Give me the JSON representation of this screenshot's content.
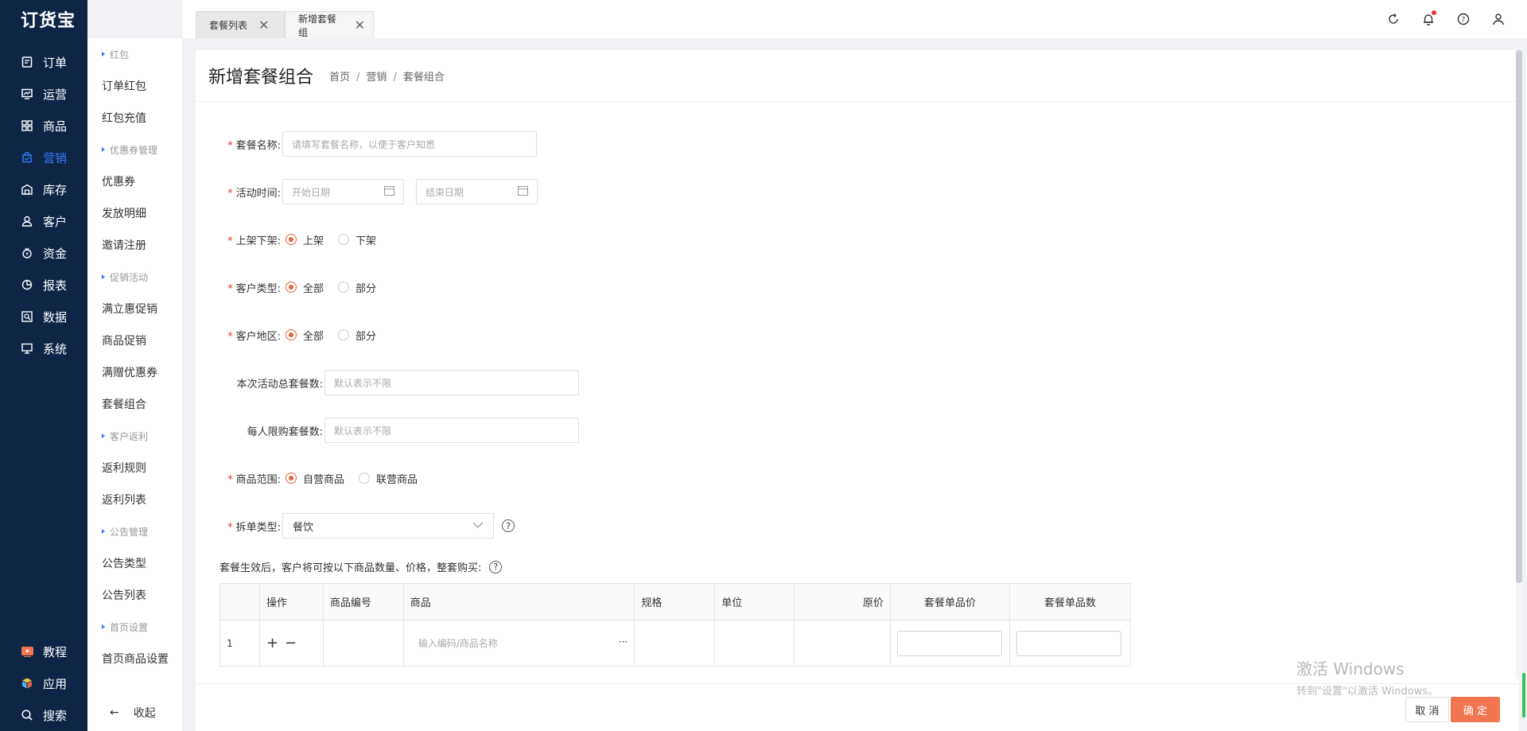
{
  "app": {
    "logo": "订货宝"
  },
  "nav": {
    "items": [
      {
        "label": "订单",
        "icon": "order-icon"
      },
      {
        "label": "运营",
        "icon": "operation-icon"
      },
      {
        "label": "商品",
        "icon": "goods-icon"
      },
      {
        "label": "营销",
        "icon": "marketing-icon",
        "active": true
      },
      {
        "label": "库存",
        "icon": "warehouse-icon"
      },
      {
        "label": "客户",
        "icon": "customer-icon"
      },
      {
        "label": "资金",
        "icon": "money-icon"
      },
      {
        "label": "报表",
        "icon": "report-icon"
      },
      {
        "label": "数据",
        "icon": "data-icon"
      },
      {
        "label": "系统",
        "icon": "system-icon"
      }
    ],
    "bottom": [
      {
        "label": "教程",
        "icon": "tutorial-icon"
      },
      {
        "label": "应用",
        "icon": "apps-icon"
      },
      {
        "label": "搜索",
        "icon": "search-icon"
      }
    ]
  },
  "submenu": {
    "groups": [
      {
        "title": "红包",
        "items": [
          "订单红包",
          "红包充值"
        ]
      },
      {
        "title": "优惠券管理",
        "items": [
          "优惠券",
          "发放明细",
          "邀请注册"
        ]
      },
      {
        "title": "促销活动",
        "items": [
          "满立惠促销",
          "商品促销",
          "满赠优惠券",
          "套餐组合"
        ]
      },
      {
        "title": "客户返利",
        "items": [
          "返利规则",
          "返利列表"
        ]
      },
      {
        "title": "公告管理",
        "items": [
          "公告类型",
          "公告列表"
        ]
      },
      {
        "title": "首页设置",
        "items": [
          "首页商品设置"
        ]
      }
    ],
    "collapse_label": "收起"
  },
  "tabs": [
    {
      "label": "套餐列表"
    },
    {
      "label": "新增套餐组"
    }
  ],
  "page": {
    "title": "新增套餐组合",
    "breadcrumb": [
      "首页",
      "营销",
      "套餐组合"
    ]
  },
  "form": {
    "name": {
      "label": "套餐名称:",
      "placeholder": "请填写套餐名称，以便于客户知悉"
    },
    "time": {
      "label": "活动时间:",
      "start_placeholder": "开始日期",
      "end_placeholder": "结束日期"
    },
    "shelf": {
      "label": "上架下架:",
      "options": [
        "上架",
        "下架"
      ],
      "selected": "上架"
    },
    "customer_type": {
      "label": "客户类型:",
      "options": [
        "全部",
        "部分"
      ],
      "selected": "全部"
    },
    "customer_region": {
      "label": "客户地区:",
      "options": [
        "全部",
        "部分"
      ],
      "selected": "全部"
    },
    "total_limit": {
      "label": "本次活动总套餐数:",
      "placeholder": "默认表示不限"
    },
    "per_person_limit": {
      "label": "每人限购套餐数:",
      "placeholder": "默认表示不限"
    },
    "goods_scope": {
      "label": "商品范围:",
      "options": [
        "自营商品",
        "联营商品"
      ],
      "selected": "自营商品"
    },
    "split_type": {
      "label": "拆单类型:",
      "value": "餐饮"
    },
    "note": "套餐生效后，客户将可按以下商品数量、价格，整套购买:"
  },
  "table": {
    "headers": [
      "",
      "操作",
      "商品编号",
      "商品",
      "规格",
      "单位",
      "原价",
      "套餐单品价",
      "套餐单品数"
    ],
    "rows": [
      {
        "index": "1",
        "code": "",
        "goods_placeholder": "输入编码/商品名称",
        "spec": "",
        "unit": "",
        "price": ""
      }
    ]
  },
  "footer": {
    "cancel": "取 消",
    "ok": "确 定"
  },
  "watermark": {
    "line1": "激活 Windows",
    "line2": "转到\"设置\"以激活 Windows。"
  },
  "colors": {
    "nav_bg": "#0f2546",
    "accent": "#2f7cf6",
    "primary_btn": "#f27552",
    "required": "#e53935"
  }
}
